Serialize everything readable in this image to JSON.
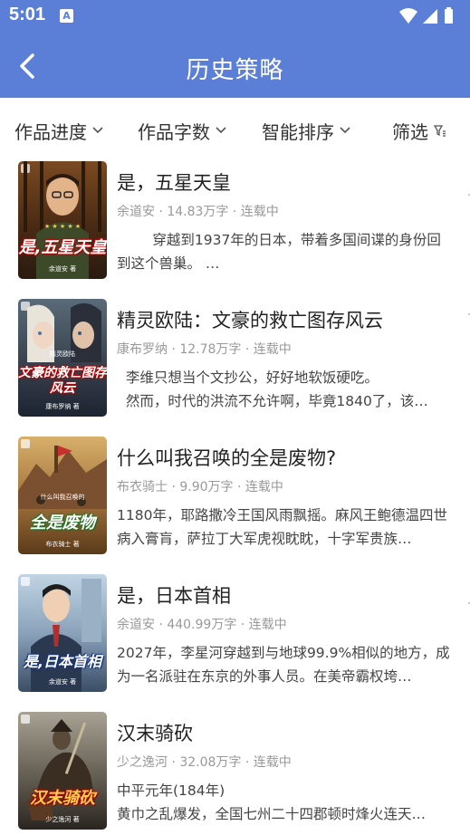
{
  "status_bar": {
    "time": "5:01",
    "notification_icon": "A"
  },
  "header": {
    "title": "历史策略",
    "back_icon": "back-arrow-icon"
  },
  "filters": [
    {
      "label": "作品进度",
      "icon": "chevron-down-icon"
    },
    {
      "label": "作品字数",
      "icon": "chevron-down-icon"
    },
    {
      "label": "智能排序",
      "icon": "chevron-down-icon"
    },
    {
      "label": "筛选",
      "icon": "filter-icon"
    }
  ],
  "books": [
    {
      "title": "是，五星天皇",
      "meta": "余道安 · 14.83万字 · 连载中",
      "description": "        穿越到1937年的日本，带着多国间谍的身份回到这个兽巢。 …",
      "cover_title": "是,五星天皇",
      "cover_author": "余道安 著",
      "cover_colors": [
        "#7a4a22",
        "#2a1a10"
      ]
    },
    {
      "title": "精灵欧陆：文豪的救亡图存风云",
      "meta": "康布罗纳 · 12.78万字 · 连载中",
      "description": "  李维只想当个文抄公，好好地软饭硬吃。\n  然而，时代的洪流不允许啊，毕竟1840了，该…",
      "cover_title": "文豪的救亡图存风云",
      "cover_author": "康布罗纳 著",
      "cover_sub": "精灵欧陆",
      "cover_colors": [
        "#5a6a78",
        "#1c2430"
      ]
    },
    {
      "title": "什么叫我召唤的全是废物?",
      "meta": "布衣骑士 · 9.90万字 · 连载中",
      "description": "1180年，耶路撒冷王国风雨飘摇。麻风王鲍德温四世病入膏肓，萨拉丁大军虎视眈眈，十字军贵族…",
      "cover_title": "全是废物",
      "cover_author": "布衣骑士 著",
      "cover_sub": "什么叫我召唤的",
      "cover_colors": [
        "#c9a05a",
        "#5a3a1a"
      ]
    },
    {
      "title": "是，日本首相",
      "meta": "余道安 · 440.99万字 · 连载中",
      "description": "2027年，李星河穿越到与地球99.9%相似的地方，成为一名派驻在东京的外事人员。在美帝霸权垮…",
      "cover_title": "是,日本首相",
      "cover_author": "余道安 著",
      "cover_colors": [
        "#c0d4e4",
        "#3a4e66"
      ]
    },
    {
      "title": "汉末骑砍",
      "meta": "少之逸河 · 32.08万字 · 连载中",
      "description": "中平元年(184年)\n黄巾之乱爆发，全国七州二十四郡顿时烽火连天…",
      "cover_title": "汉末骑砍",
      "cover_author": "少之逸河 著",
      "cover_colors": [
        "#8a8478",
        "#2a2520"
      ]
    }
  ]
}
